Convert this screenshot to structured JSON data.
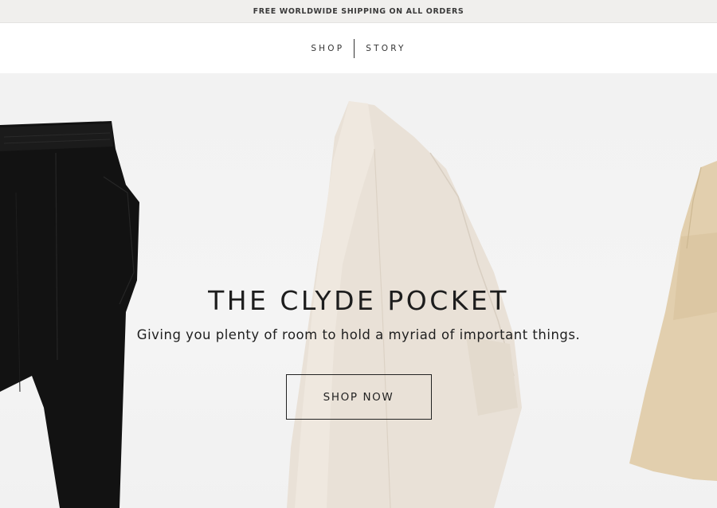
{
  "announcement": {
    "text": "FREE WORLDWIDE SHIPPING ON ALL ORDERS"
  },
  "nav": {
    "items": [
      {
        "label": "SHOP"
      },
      {
        "label": "STORY"
      }
    ]
  },
  "hero": {
    "title": "THE CLYDE POCKET",
    "subtitle": "Giving you plenty of room to hold a myriad of important things.",
    "cta_label": "SHOP NOW"
  },
  "colors": {
    "announcement_bg": "#f0efed",
    "hero_bg": "#f2f2f2",
    "pants": "#111111",
    "shirt": "#e9e1d7",
    "skirt": "#e2cfae"
  }
}
